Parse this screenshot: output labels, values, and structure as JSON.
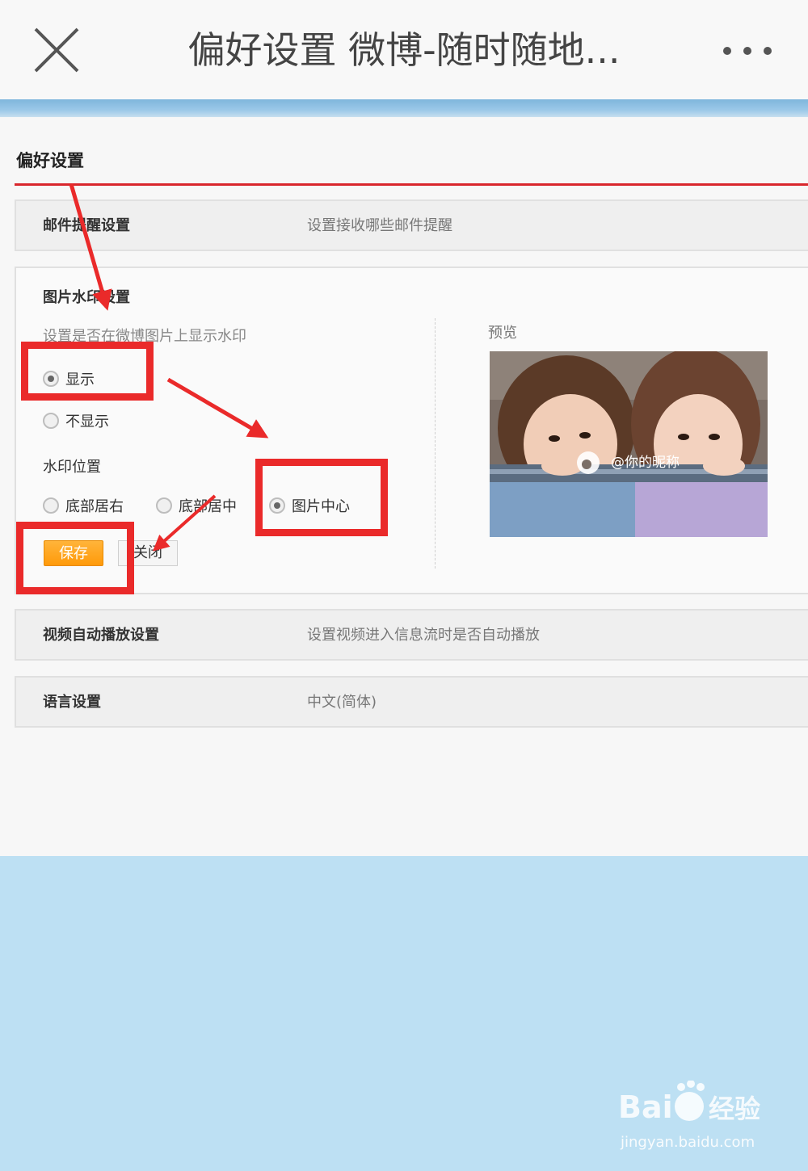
{
  "topbar": {
    "title": "偏好设置 微博-随时随地..."
  },
  "page": {
    "title": "偏好设置",
    "rows": {
      "email": {
        "label": "邮件提醒设置",
        "desc": "设置接收哪些邮件提醒"
      },
      "video": {
        "label": "视频自动播放设置",
        "desc": "设置视频进入信息流时是否自动播放"
      },
      "language": {
        "label": "语言设置",
        "desc": "中文(简体)"
      }
    },
    "watermark": {
      "title": "图片水印设置",
      "subtitle": "设置是否在微博图片上显示水印",
      "show_label": "显示",
      "hide_label": "不显示",
      "show_selected": true,
      "position_label": "水印位置",
      "positions": [
        "底部居右",
        "底部居中",
        "图片中心"
      ],
      "selected_position": "图片中心",
      "save_label": "保存",
      "close_label": "关闭",
      "preview_label": "预览",
      "preview_watermark": "@你的昵称"
    }
  },
  "footer": {
    "logo_text": "Bai 经验",
    "url": "jingyan.baidu.com"
  },
  "colors": {
    "accent_red": "#d9262c",
    "save_orange": "#ff9a0a",
    "annotation_red": "#ea2a2a"
  }
}
